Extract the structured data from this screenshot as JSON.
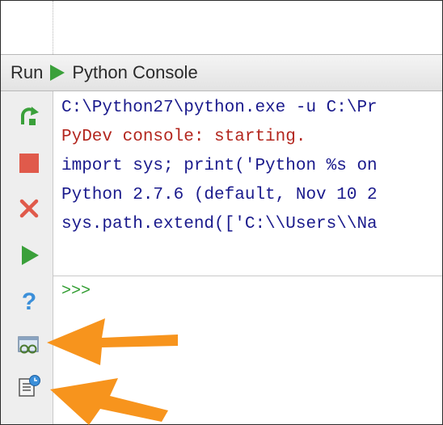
{
  "tool_window": {
    "run_label": "Run",
    "tab_title": "Python Console"
  },
  "console": {
    "lines": [
      {
        "text": "C:\\Python27\\python.exe -u C:\\Pr",
        "color": "#1a1a8c"
      },
      {
        "text": "PyDev console: starting.",
        "color": "#b3261e"
      },
      {
        "text": "import sys; print('Python %s on",
        "color": "#1a1a8c"
      },
      {
        "text": "Python 2.7.6 (default, Nov 10 2",
        "color": "#1a1a8c"
      },
      {
        "text": "sys.path.extend(['C:\\\\Users\\\\Na",
        "color": "#1a1a8c"
      }
    ],
    "prompt": ">>>"
  },
  "toolbar": {
    "icons": [
      "rerun-icon",
      "stop-icon",
      "close-icon",
      "execute-icon",
      "help-icon",
      "variables-view-icon",
      "history-icon"
    ]
  },
  "colors": {
    "annotation_arrow": "#f7941d",
    "green": "#3aa03a",
    "red": "#e05a4b"
  }
}
